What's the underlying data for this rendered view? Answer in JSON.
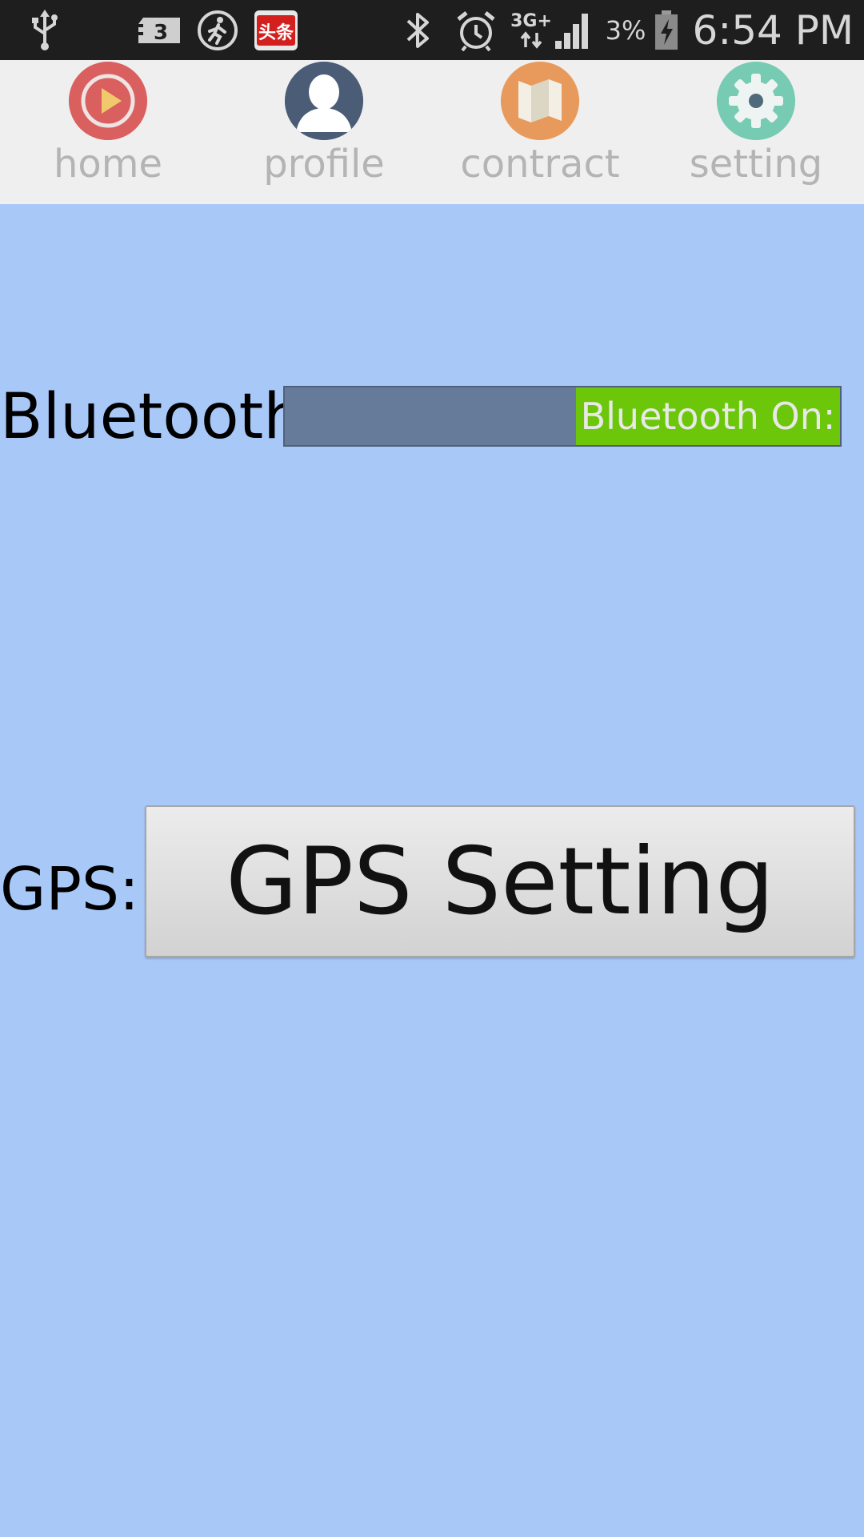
{
  "status_bar": {
    "icons_left": [
      "usb-icon",
      "sd-card-icon",
      "runner-icon",
      "news-app-icon"
    ],
    "news_app_text": "头条",
    "icons_right": [
      "bluetooth-icon",
      "alarm-icon",
      "network-3g-icon",
      "signal-icon",
      "battery-charging-icon"
    ],
    "network_type": "3G+",
    "sd_badge": "3",
    "battery_percent": "3%",
    "time": "6:54 PM"
  },
  "nav": {
    "items": [
      {
        "label": "home",
        "icon": "play-icon",
        "color": "#d9605f"
      },
      {
        "label": "profile",
        "icon": "person-icon",
        "color": "#4b5c77"
      },
      {
        "label": "contract",
        "icon": "map-icon",
        "color": "#e89a5c"
      },
      {
        "label": "setting",
        "icon": "gear-icon",
        "color": "#77cbb3"
      }
    ]
  },
  "bluetooth": {
    "label": "Bluetooth:",
    "toggle_text": "Bluetooth On:",
    "state": "on",
    "on_color": "#6cc70a",
    "track_color": "#667a9a"
  },
  "gps": {
    "label": "GPS:",
    "button_label": "GPS Setting"
  },
  "colors": {
    "background": "#a8c8f8",
    "nav_background": "#efefef",
    "status_bar": "#1e1e1e"
  }
}
